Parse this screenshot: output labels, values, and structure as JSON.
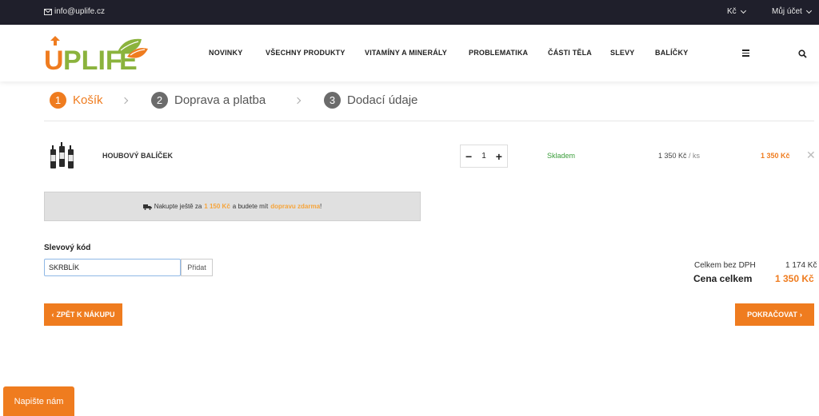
{
  "topbar": {
    "email": "info@uplife.cz",
    "currency": "Kč",
    "account": "Můj účet"
  },
  "brand": {
    "name": "UPLIFE",
    "accent": "#ef7c1f",
    "leaf": "#8bb33d"
  },
  "nav": {
    "items": [
      "NOVINKY",
      "VŠECHNY PRODUKTY",
      "VITAMÍNY A MINERÁLY",
      "PROBLEMATIKA",
      "ČÁSTI TĚLA",
      "SLEVY",
      "BALÍČKY"
    ]
  },
  "steps": [
    {
      "num": "1",
      "label": "Košík"
    },
    {
      "num": "2",
      "label": "Doprava a platba"
    },
    {
      "num": "3",
      "label": "Dodací údaje"
    }
  ],
  "cart": {
    "item": {
      "name": "HOUBOVÝ BALÍČEK",
      "quantity": "1",
      "stock": "Skladem",
      "unit_price": "1 350 Kč",
      "unit_suffix": "/ ks",
      "total": "1 350 Kč"
    }
  },
  "shipping_notice": {
    "prefix": "Nakupte ještě za",
    "amount": "1 150 Kč",
    "middle": "a budete mít",
    "highlight": "dopravu zdarma",
    "suffix": "!"
  },
  "coupon": {
    "label": "Slevový kód",
    "value": "SKRBLÍK",
    "button": "Přidat"
  },
  "summary": {
    "net_label": "Celkem bez DPH",
    "net_value": "1 174 Kč",
    "total_label": "Cena celkem",
    "total_value": "1 350 Kč"
  },
  "actions": {
    "back": "ZPĚT K NÁKUPU",
    "continue": "POKRAČOVAT"
  },
  "chat": {
    "label": "Napište nám"
  }
}
